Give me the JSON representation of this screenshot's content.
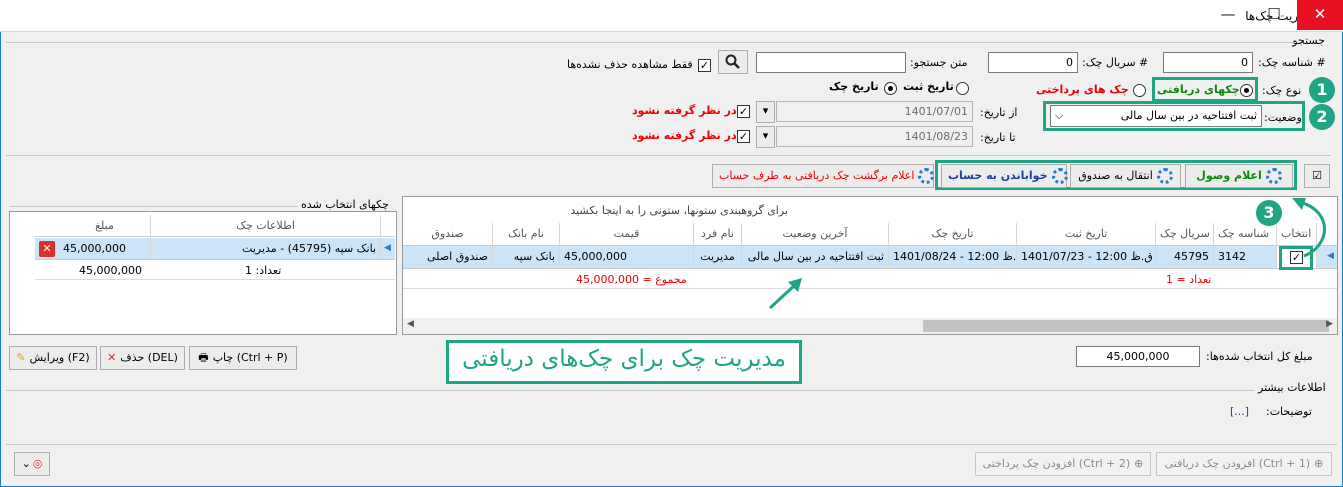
{
  "window": {
    "title": "مدیریت چک‌ها",
    "min": "—",
    "max": "☐",
    "close": "✕"
  },
  "search": {
    "group_title": "جستجو",
    "check_id_label": "# شناسه چک:",
    "check_id_value": "0",
    "serial_label": "# سریال چک:",
    "serial_value": "0",
    "text_label": "متن جستجو:",
    "text_value": "",
    "deleted_only_label": "فقط مشاهده حذف نشده‌ها",
    "type_label": "نوع چک:",
    "type_received": "چکهای دریافتی",
    "type_paid": "چک های پرداختی",
    "date_register": "تاریخ ثبت",
    "date_check": "تاریخ چک",
    "status_label": "وضعیت:",
    "status_value": "ثبت افتتاحیه در بین سال مالی",
    "from_label": "از تاریخ:",
    "from_value": "1401/07/01",
    "to_label": "تا تاریخ:",
    "to_value": "1401/08/23",
    "ignore_label": "در نظر گرفته نشود"
  },
  "actions": {
    "confirm": "اعلام وصول",
    "to_box": "انتقال به صندوق",
    "to_account": "خواباندن به حساب",
    "return": "اعلام برگشت چک دریافتی به طرف حساب"
  },
  "grid": {
    "group_hint": "برای گروهبندی ستونها، ستونی را به اینجا بکشید",
    "columns": [
      "انتخاب",
      "شناسه چک",
      "سریال چک",
      "تاریخ ثبت",
      "تاریخ چک",
      "آخرین وضعیت",
      "نام فرد",
      "قیمت",
      "نام بانک",
      "صندوق"
    ],
    "row": {
      "id": "3142",
      "serial": "45795",
      "reg_date": "1401/07/23 - 12:00 ق.ظ",
      "check_date": "1401/08/24 - 12:00 ق.ظ",
      "status": "ثبت افتتاحیه در بین سال مالی",
      "person": "مدیریت",
      "price": "45,000,000",
      "bank": "بانک سپه",
      "box": "صندوق اصلی"
    },
    "count": "تعداد = 1",
    "sum": "مجموع = 45,000,000"
  },
  "selected": {
    "title": "چکهای انتخاب شده",
    "col_info": "اطلاعات چک",
    "col_amount": "مبلغ",
    "row_info": "بانک سپه (45795) - مدیریت",
    "row_amount": "45,000,000",
    "count": "تعداد: 1",
    "total": "45,000,000"
  },
  "bottom": {
    "print": "چاپ (Ctrl + P)",
    "delete": "حذف (DEL)",
    "edit": "ویرایش (F2)",
    "total_label": "مبلغ کل انتخاب شده‌ها:",
    "total_value": "45,000,000",
    "more_info": "اطلاعات بیشتر",
    "desc_label": "توضیحات:",
    "desc_link": "[...]",
    "add_received": "افزودن چک دریافتی (Ctrl + 1)",
    "add_paid": "افزودن چک پرداختی (Ctrl + 2)"
  },
  "annotation": {
    "caption": "مدیریت چک برای چک‌های دریافتی",
    "n1": "1",
    "n2": "2",
    "n3": "3"
  },
  "colors": {
    "accent": "#20a486",
    "title_bar": "#ffffff",
    "close": "#e81123",
    "selection": "#cce4f7"
  }
}
